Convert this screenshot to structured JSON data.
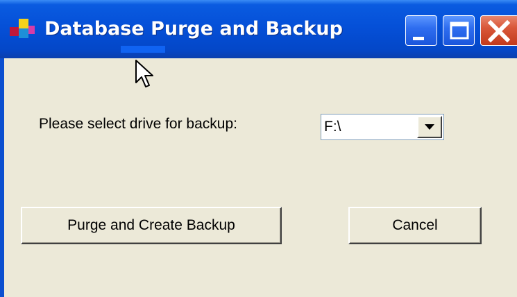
{
  "window": {
    "title": "Database Purge and Backup"
  },
  "form": {
    "drive_label": "Please select drive for backup:",
    "drive_value": "F:\\"
  },
  "buttons": {
    "purge_label": "Purge and Create Backup",
    "cancel_label": "Cancel"
  },
  "icons": {
    "app": "app-icon",
    "minimize": "minimize-icon",
    "maximize": "maximize-icon",
    "close": "close-icon",
    "dropdown": "dropdown-arrow-icon",
    "cursor": "mouse-cursor-icon"
  },
  "colors": {
    "titlebar": "#0550d8",
    "client": "#ece9d8",
    "close_button": "#d9583a"
  }
}
